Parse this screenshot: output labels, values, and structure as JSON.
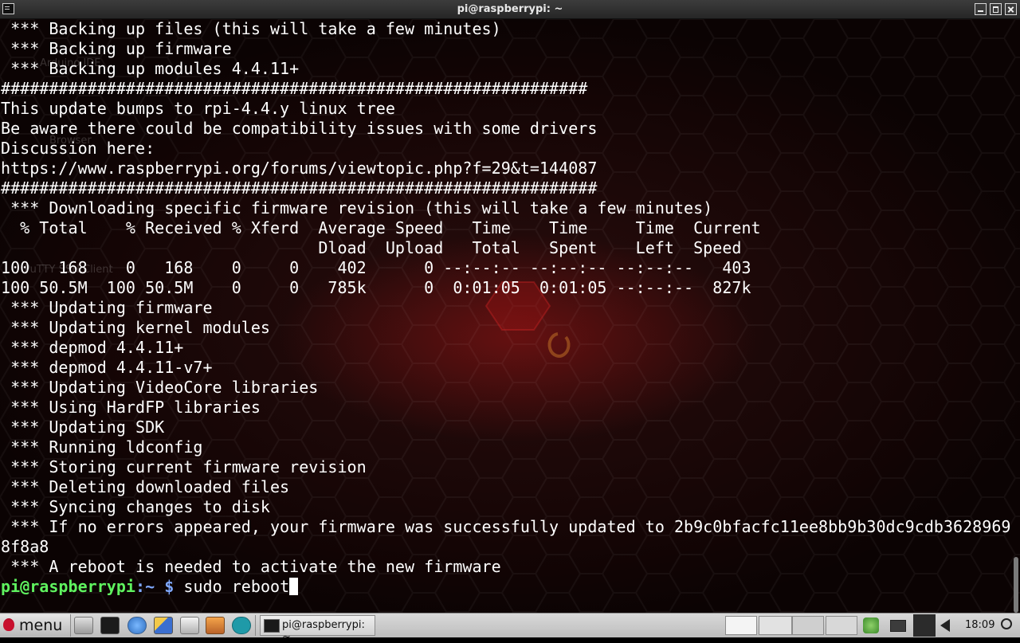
{
  "window": {
    "title": "pi@raspberrypi: ~"
  },
  "terminal": {
    "lines": [
      " *** Backing up files (this will take a few minutes)",
      " *** Backing up firmware",
      " *** Backing up modules 4.4.11+",
      "#############################################################",
      "This update bumps to rpi-4.4.y linux tree",
      "Be aware there could be compatibility issues with some drivers",
      "Discussion here:",
      "https://www.raspberrypi.org/forums/viewtopic.php?f=29&t=144087",
      "##############################################################",
      " *** Downloading specific firmware revision (this will take a few minutes)",
      "  % Total    % Received % Xferd  Average Speed   Time    Time     Time  Current",
      "                                 Dload  Upload   Total   Spent    Left  Speed",
      "100   168    0   168    0     0    402      0 --:--:-- --:--:-- --:--:--   403",
      "100 50.5M  100 50.5M    0     0   785k      0  0:01:05  0:01:05 --:--:--  827k",
      " *** Updating firmware",
      " *** Updating kernel modules",
      " *** depmod 4.4.11+",
      " *** depmod 4.4.11-v7+",
      " *** Updating VideoCore libraries",
      " *** Using HardFP libraries",
      " *** Updating SDK",
      " *** Running ldconfig",
      " *** Storing current firmware revision",
      " *** Deleting downloaded files",
      " *** Syncing changes to disk",
      " *** If no errors appeared, your firmware was successfully updated to 2b9c0bfacfc11ee8bb9b30dc9cdb3628969",
      "8f8a8",
      " *** A reboot is needed to activate the new firmware"
    ],
    "prompt": {
      "user_host": "pi@raspberrypi",
      "path": ":~",
      "symbol": " $ ",
      "command": "sudo reboot"
    },
    "colors": {
      "text": "#ffffff",
      "prompt_user": "#5ff35f",
      "prompt_path": "#7fa8ff"
    }
  },
  "desktop_ghost_labels": {
    "arduino": "Arduino IDE",
    "browser": "Browser",
    "putty": "PuTTY SSH Client"
  },
  "taskbar": {
    "menu_label": "menu",
    "launchers": [
      "wrench-icon",
      "terminal-icon",
      "file-manager-icon",
      "network-icon",
      "files-icon",
      "home-icon",
      "arduino-icon"
    ],
    "task_label": "pi@raspberrypi: ~",
    "clock": "18:09"
  }
}
